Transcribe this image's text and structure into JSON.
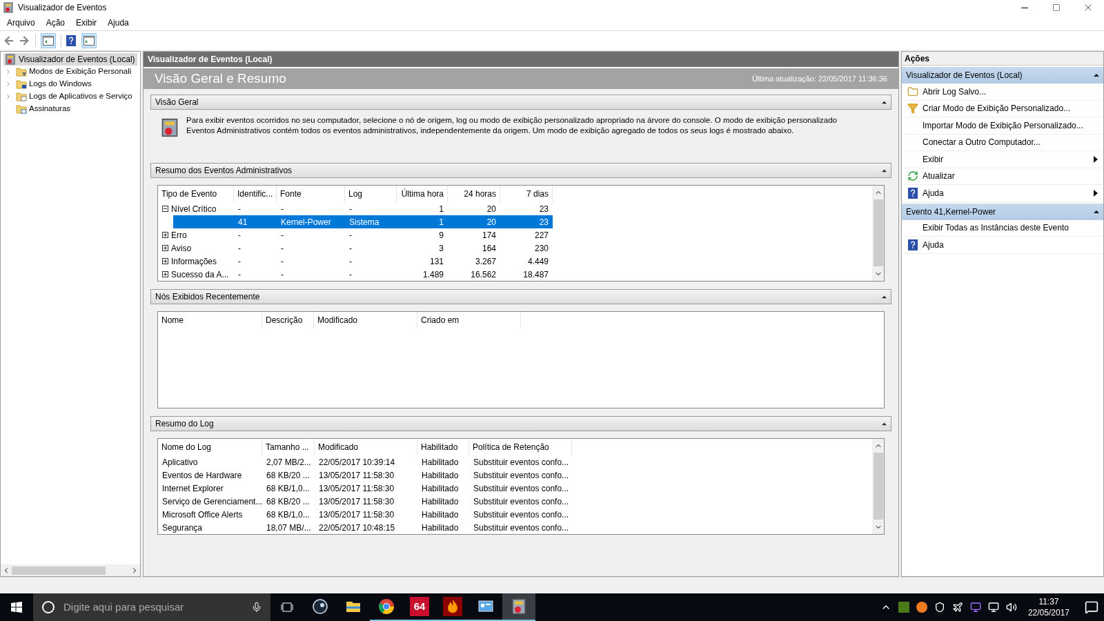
{
  "window": {
    "title": "Visualizador de Eventos"
  },
  "menu": [
    "Arquivo",
    "Ação",
    "Exibir",
    "Ajuda"
  ],
  "tree": {
    "label": "Visualizador de Eventos (Local)",
    "selected": true,
    "children": [
      {
        "label": "Modos de Exibição Personali",
        "kind": "filter-folder",
        "expanded": false
      },
      {
        "label": "Logs do Windows",
        "kind": "windows-folder",
        "expanded": false
      },
      {
        "label": "Logs de Aplicativos e Serviço",
        "kind": "app-folder",
        "expanded": false
      },
      {
        "label": "Assinaturas",
        "kind": "subscription"
      }
    ]
  },
  "center": {
    "header": "Visualizador de Eventos (Local)",
    "title": "Visão Geral e Resumo",
    "last_update": "Última atualização: 22/05/2017 11:36:36",
    "overview": {
      "title": "Visão Geral",
      "expanded": true,
      "text": "Para exibir eventos ocorridos no seu computador, selecione o nó de origem, log ou modo de exibição personalizado apropriado na árvore do console. O modo de exibição personalizado Eventos Administrativos contém todos os eventos administrativos, independentemente da origem. Um modo de exibição agregado de todos os seus logs é mostrado abaixo."
    },
    "admin_summary": {
      "title": "Resumo dos Eventos Administrativos",
      "expanded": true,
      "columns": [
        "Tipo de Evento",
        "Identific...",
        "Fonte",
        "Log",
        "Última hora",
        "24 horas",
        "7 dias"
      ],
      "rows": [
        {
          "type": "Nível Crítico",
          "id": "-",
          "source": "-",
          "log": "-",
          "last_hour": "1",
          "h24": "20",
          "d7": "23",
          "expanded": true,
          "selected": false,
          "children": [
            {
              "id": "41",
              "source": "Kernel-Power",
              "log": "Sistema",
              "last_hour": "1",
              "h24": "20",
              "d7": "23",
              "selected": true
            }
          ]
        },
        {
          "type": "Erro",
          "id": "-",
          "source": "-",
          "log": "-",
          "last_hour": "9",
          "h24": "174",
          "d7": "227",
          "expanded": false,
          "selected": false
        },
        {
          "type": "Aviso",
          "id": "-",
          "source": "-",
          "log": "-",
          "last_hour": "3",
          "h24": "164",
          "d7": "230",
          "expanded": false,
          "selected": false
        },
        {
          "type": "Informações",
          "id": "-",
          "source": "-",
          "log": "-",
          "last_hour": "131",
          "h24": "3.267",
          "d7": "4.449",
          "expanded": false,
          "selected": false
        },
        {
          "type": "Sucesso da A...",
          "id": "-",
          "source": "-",
          "log": "-",
          "last_hour": "1.489",
          "h24": "16.562",
          "d7": "18.487",
          "expanded": false,
          "selected": false
        }
      ]
    },
    "recent_nodes": {
      "title": "Nós Exibidos Recentemente",
      "expanded": true,
      "columns": [
        "Nome",
        "Descrição",
        "Modificado",
        "Criado em"
      ]
    },
    "log_summary": {
      "title": "Resumo do Log",
      "expanded": true,
      "columns": [
        "Nome do Log",
        "Tamanho ...",
        "Modificado",
        "Habilitado",
        "Política de Retenção"
      ],
      "rows": [
        [
          "Aplicativo",
          "2,07 MB/2...",
          "22/05/2017 10:39:14",
          "Habilitado",
          "Substituir eventos confo..."
        ],
        [
          "Eventos de Hardware",
          "68 KB/20 ...",
          "13/05/2017 11:58:30",
          "Habilitado",
          "Substituir eventos confo..."
        ],
        [
          "Internet Explorer",
          "68 KB/1,0...",
          "13/05/2017 11:58:30",
          "Habilitado",
          "Substituir eventos confo..."
        ],
        [
          "Serviço de Gerenciament...",
          "68 KB/20 ...",
          "13/05/2017 11:58:30",
          "Habilitado",
          "Substituir eventos confo..."
        ],
        [
          "Microsoft Office Alerts",
          "68 KB/1,0...",
          "13/05/2017 11:58:30",
          "Habilitado",
          "Substituir eventos confo..."
        ],
        [
          "Segurança",
          "18,07 MB/...",
          "22/05/2017 10:48:15",
          "Habilitado",
          "Substituir eventos confo..."
        ]
      ]
    }
  },
  "actions": {
    "title": "Ações",
    "groups": [
      {
        "title": "Visualizador de Eventos (Local)",
        "expanded": true,
        "items": [
          {
            "label": "Abrir Log Salvo...",
            "kind": "folder",
            "submenu": false
          },
          {
            "label": "Criar Modo de Exibição Personalizado...",
            "kind": "filter",
            "submenu": false
          },
          {
            "label": "Importar Modo de Exibição Personalizado...",
            "kind": "none",
            "submenu": false
          },
          {
            "label": "Conectar a Outro Computador...",
            "kind": "none",
            "submenu": false
          },
          {
            "label": "Exibir",
            "kind": "none",
            "submenu": true
          },
          {
            "label": "Atualizar",
            "kind": "refresh",
            "submenu": false
          },
          {
            "label": "Ajuda",
            "kind": "help",
            "submenu": true
          }
        ]
      },
      {
        "title": "Evento 41,Kernel-Power",
        "expanded": true,
        "items": [
          {
            "label": "Exibir Todas as Instâncias deste Evento",
            "kind": "none",
            "submenu": false
          },
          {
            "label": "Ajuda",
            "kind": "help",
            "submenu": false
          }
        ]
      }
    ]
  },
  "taskbar": {
    "search_placeholder": "Digite aqui para pesquisar",
    "apps": [
      {
        "kind": "steam",
        "running": false,
        "selected": false
      },
      {
        "kind": "explorer",
        "running": false,
        "selected": false
      },
      {
        "kind": "chrome",
        "running": true,
        "selected": false
      },
      {
        "kind": "badge",
        "label": "64",
        "running": true,
        "selected": false
      },
      {
        "kind": "fire",
        "running": true,
        "selected": false
      },
      {
        "kind": "panel",
        "running": true,
        "selected": false
      },
      {
        "kind": "eventlog",
        "running": true,
        "selected": true
      }
    ],
    "time": "11:37",
    "date": "22/05/2017"
  }
}
